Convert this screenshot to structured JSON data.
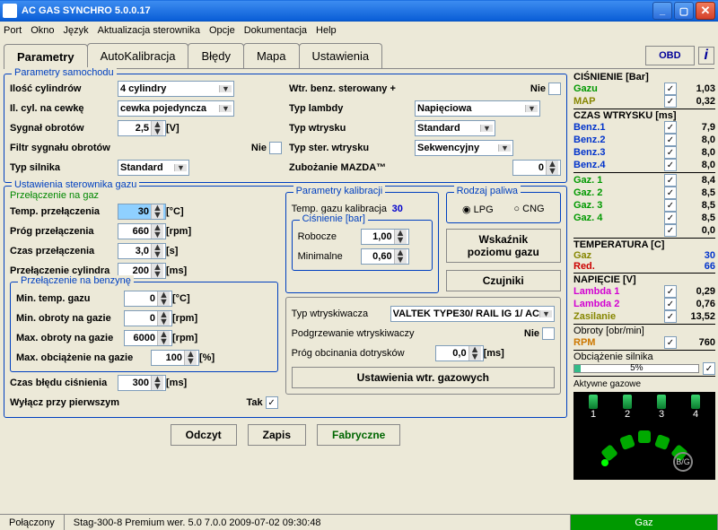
{
  "window": {
    "title": "AC GAS SYNCHRO  5.0.0.17"
  },
  "menu": [
    "Port",
    "Okno",
    "Język",
    "Aktualizacja sterownika",
    "Opcje",
    "Dokumentacja",
    "Help"
  ],
  "tabs": {
    "items": [
      "Parametry",
      "AutoKalibracja",
      "Błędy",
      "Mapa",
      "Ustawienia"
    ],
    "obd": "OBD"
  },
  "groups": {
    "car_params": {
      "legend": "Parametry samochodu",
      "cyl_count_label": "Ilość cylindrów",
      "cyl_count": "4 cylindry",
      "cyl_per_coil_label": "Il. cyl. na cewkę",
      "cyl_per_coil": "cewka pojedyncza",
      "rpm_signal_label": "Sygnał obrotów",
      "rpm_signal": "2,5",
      "rpm_signal_unit": "[V]",
      "rpm_filter_label": "Filtr sygnału obrotów",
      "rpm_filter": "Nie",
      "engine_type_label": "Typ silnika",
      "engine_type": "Standard",
      "inj_plus_label": "Wtr. benz. sterowany +",
      "inj_plus": "Nie",
      "lambda_type_label": "Typ lambdy",
      "lambda_type": "Napięciowa",
      "inj_type_label": "Typ wtrysku",
      "inj_type": "Standard",
      "inj_ctrl_label": "Typ ster. wtrysku",
      "inj_ctrl": "Sekwencyjny",
      "lean_mazda_label": "Zubożanie MAZDA™",
      "lean_mazda": "0"
    },
    "gas_ctrl": {
      "legend": "Ustawienia sterownika gazu",
      "switch_gas_legend": "Przełączenie na gaz",
      "temp_sw_label": "Temp. przełączenia",
      "temp_sw": "30",
      "temp_sw_unit": "[°C]",
      "thresh_label": "Próg przełączenia",
      "thresh": "660",
      "thresh_unit": "[rpm]",
      "time_sw_label": "Czas przełączenia",
      "time_sw": "3,0",
      "time_sw_unit": "[s]",
      "cyl_sw_label": "Przełączenie cylindra",
      "cyl_sw": "200",
      "cyl_sw_unit": "[ms]",
      "switch_petrol_legend": "Przełączenie na benzynę",
      "min_temp_label": "Min. temp. gazu",
      "min_temp": "0",
      "min_temp_unit": "[°C]",
      "min_rpm_label": "Min. obroty na gazie",
      "min_rpm": "0",
      "min_rpm_unit": "[rpm]",
      "max_rpm_label": "Max. obroty na gazie",
      "max_rpm": "6000",
      "max_rpm_unit": "[rpm]",
      "max_load_label": "Max. obciążenie na gazie",
      "max_load": "100",
      "max_load_unit": "[%]",
      "err_time_label": "Czas błędu ciśnienia",
      "err_time": "300",
      "err_time_unit": "[ms]",
      "cut_first_label": "Wyłącz przy pierwszym",
      "cut_first": "Tak",
      "cal_legend": "Parametry kalibracji",
      "cal_temp_label": "Temp. gazu kalibracja",
      "cal_temp": "30",
      "press_legend": "Ciśnienie [bar]",
      "press_work_label": "Robocze",
      "press_work": "1,00",
      "press_min_label": "Minimalne",
      "press_min": "0,60",
      "fuel_legend": "Rodzaj paliwa",
      "fuel_lpg": "LPG",
      "fuel_cng": "CNG",
      "level_btn": "Wskaźnik poziomu gazu",
      "sensors_btn": "Czujniki",
      "inj_type2_label": "Typ wtryskiwacza",
      "inj_type2": "VALTEK TYPE30/ RAIL IG 1/ AC",
      "heater_label": "Podgrzewanie wtryskiwaczy",
      "heater": "Nie",
      "cutoff_label": "Próg obcinania dotrysków",
      "cutoff": "0,0",
      "cutoff_unit": "[ms]",
      "gas_inj_settings_btn": "Ustawienia wtr. gazowych"
    }
  },
  "btns": {
    "read": "Odczyt",
    "write": "Zapis",
    "factory": "Fabryczne"
  },
  "right": {
    "pressure_head": "CIŚNIENIE [Bar]",
    "gas": "Gazu",
    "gas_v": "1,03",
    "map": "MAP",
    "map_v": "0,32",
    "inj_head": "CZAS WTRYSKU  [ms]",
    "b": [
      {
        "n": "Benz.1",
        "v": "7,9"
      },
      {
        "n": "Benz.2",
        "v": "8,0"
      },
      {
        "n": "Benz.3",
        "v": "8,0"
      },
      {
        "n": "Benz.4",
        "v": "8,0"
      }
    ],
    "g": [
      {
        "n": "Gaz. 1",
        "v": "8,4"
      },
      {
        "n": "Gaz. 2",
        "v": "8,5"
      },
      {
        "n": "Gaz. 3",
        "v": "8,5"
      },
      {
        "n": "Gaz. 4",
        "v": "8,5"
      },
      {
        "n": "",
        "v": "0,0"
      }
    ],
    "temp_head": "TEMPERATURA [C]",
    "t_gas": "Gaz",
    "t_gas_v": "30",
    "t_red": "Red.",
    "t_red_v": "66",
    "volt_head": "NAPIĘCIE [V]",
    "l1": "Lambda 1",
    "l1_v": "0,29",
    "l2": "Lambda 2",
    "l2_v": "0,76",
    "supply": "Zasilanie",
    "supply_v": "13,52",
    "rpm_head": "Obroty [obr/min]",
    "rpm": "RPM",
    "rpm_v": "760",
    "load_head": "Obciążenie silnika",
    "load_v": "5%",
    "active_gas": "Aktywne gazowe",
    "cylnums": [
      "1",
      "2",
      "3",
      "4"
    ],
    "bg": "B/G"
  },
  "status": {
    "conn": "Połączony",
    "info": "Stag-300-8 Premium   wer. 5.0  7.0.0    2009-07-02 09:30:48",
    "mode": "Gaz"
  }
}
